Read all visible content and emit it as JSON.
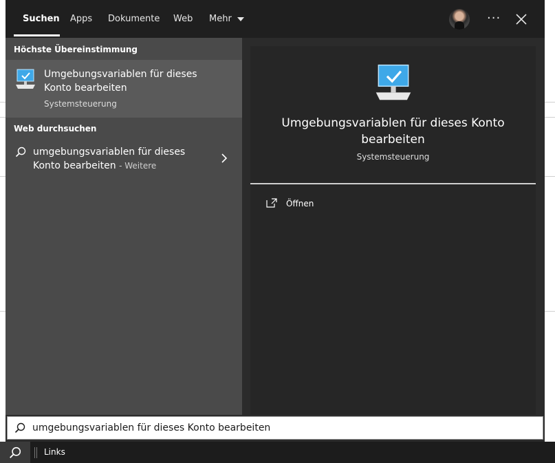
{
  "tabs": [
    {
      "label": "Suchen"
    },
    {
      "label": "Apps"
    },
    {
      "label": "Dokumente"
    },
    {
      "label": "Web"
    },
    {
      "label": "Mehr"
    }
  ],
  "header": {
    "more_dots": "···"
  },
  "sections": {
    "best_match": "Höchste Übereinstimmung",
    "web_search": "Web durchsuchen"
  },
  "best_match": {
    "title": "Umgebungsvariablen für dieses Konto bearbeiten",
    "subtitle": "Systemsteuerung",
    "icon": "control-panel-monitor-icon"
  },
  "web_result": {
    "query": "umgebungsvariablen für dieses Konto bearbeiten",
    "more": "- Weitere"
  },
  "preview": {
    "title": "Umgebungsvariablen für dieses Konto bearbeiten",
    "subtitle": "Systemsteuerung",
    "action_open": "Öffnen"
  },
  "search": {
    "value": "umgebungsvariablen für dieses Konto bearbeiten"
  },
  "taskbar": {
    "links_label": "Links"
  },
  "colors": {
    "accent": "#3ea8e8",
    "panel": "#2b2b2b",
    "header": "#1f1f1f",
    "left_pane": "#4a4a4a"
  }
}
